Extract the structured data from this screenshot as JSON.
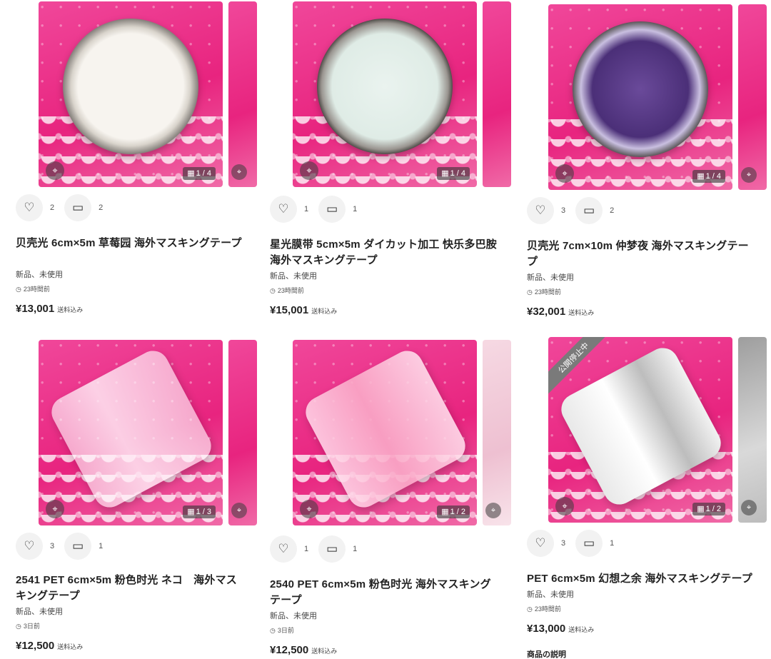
{
  "ui": {
    "lens_icon": "⌖",
    "grid_icon": "▦",
    "heart_icon": "♡",
    "comment_icon": "▭",
    "clock_icon": "◷"
  },
  "products": [
    {
      "likes": "2",
      "comments": "2",
      "title": "贝壳光 6cm×5m 草莓园 海外マスキングテープ",
      "condition": "新品、未使用",
      "time": "23時間前",
      "price": "¥13,001",
      "shipping": "送料込み",
      "image_count": "1 / 4",
      "color_hint": "#ec2c85"
    },
    {
      "likes": "1",
      "comments": "1",
      "title": "星光膜带 5cm×5m ダイカット加工 快乐多巴胺 海外マスキングテープ",
      "condition": "新品、未使用",
      "time": "23時間前",
      "price": "¥15,001",
      "shipping": "送料込み",
      "image_count": "1 / 4",
      "color_hint": "#ec2c85"
    },
    {
      "likes": "3",
      "comments": "2",
      "title": "贝壳光 7cm×10m 仲梦夜 海外マスキングテープ",
      "condition": "新品、未使用",
      "time": "23時間前",
      "price": "¥32,001",
      "shipping": "送料込み",
      "image_count": "1 / 4",
      "color_hint": "#ec2c85"
    },
    {
      "likes": "3",
      "comments": "1",
      "title": "2541 PET 6cm×5m 粉色时光 ネコ　海外マスキングテープ",
      "condition": "新品、未使用",
      "time": "3日前",
      "price": "¥12,500",
      "shipping": "送料込み",
      "image_count": "1 / 3",
      "color_hint": "#ec2c85"
    },
    {
      "likes": "1",
      "comments": "1",
      "title": "2540 PET 6cm×5m 粉色时光 海外マスキングテープ",
      "condition": "新品、未使用",
      "time": "3日前",
      "price": "¥12,500",
      "shipping": "送料込み",
      "image_count": "1 / 2",
      "color_hint": "#ec2c85"
    },
    {
      "likes": "3",
      "comments": "1",
      "title": "PET 6cm×5m 幻想之余 海外マスキングテープ",
      "condition": "新品、未使用",
      "time": "23時間前",
      "price": "¥13,000",
      "shipping": "送料込み",
      "image_count": "1 / 2",
      "ribbon": "公開停止中",
      "description_heading": "商品の説明",
      "color_hint": "#ec2c85"
    }
  ]
}
